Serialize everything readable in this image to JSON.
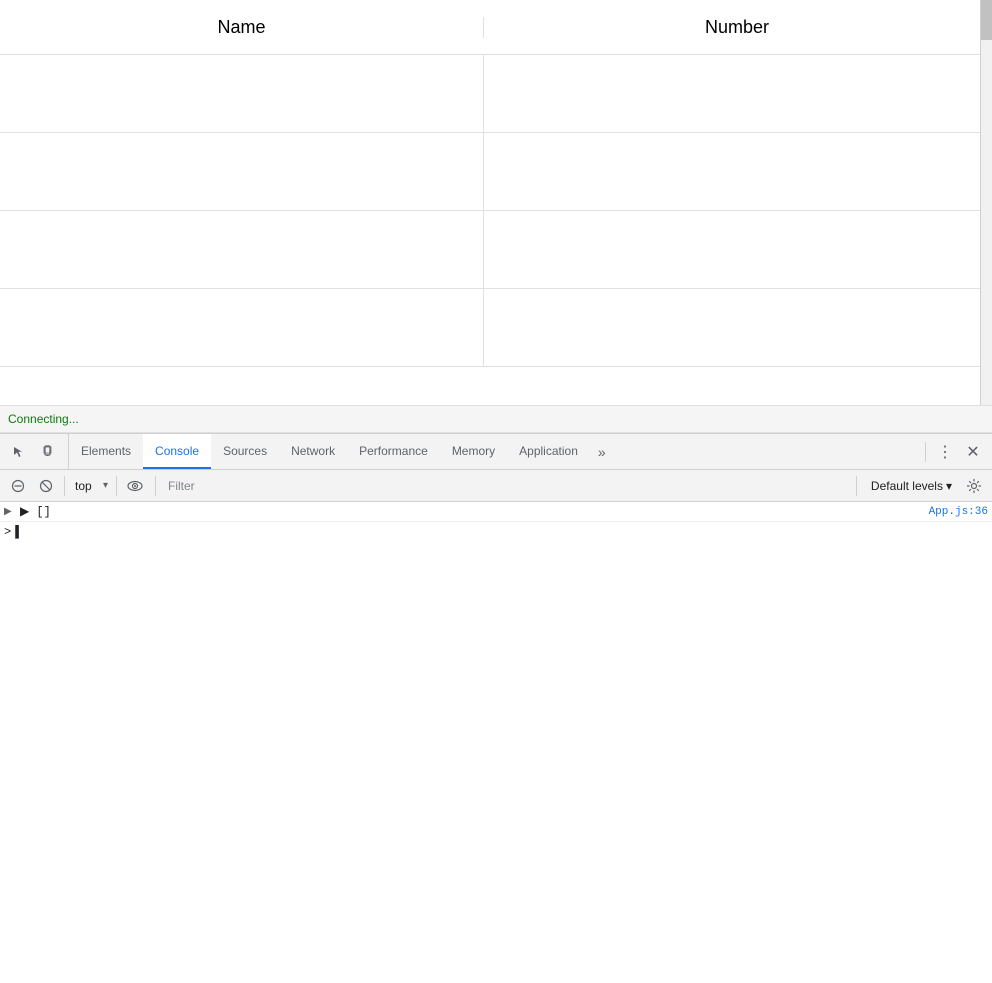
{
  "table": {
    "columns": [
      {
        "id": "name",
        "label": "Name"
      },
      {
        "id": "number",
        "label": "Number"
      }
    ],
    "rows": [
      {
        "name": "",
        "number": ""
      },
      {
        "name": "",
        "number": ""
      },
      {
        "name": "",
        "number": ""
      },
      {
        "name": "",
        "number": ""
      }
    ]
  },
  "connecting": {
    "text": "Connecting..."
  },
  "devtools": {
    "tabs": [
      {
        "id": "elements",
        "label": "Elements",
        "active": false
      },
      {
        "id": "console",
        "label": "Console",
        "active": true
      },
      {
        "id": "sources",
        "label": "Sources",
        "active": false
      },
      {
        "id": "network",
        "label": "Network",
        "active": false
      },
      {
        "id": "performance",
        "label": "Performance",
        "active": false
      },
      {
        "id": "memory",
        "label": "Memory",
        "active": false
      },
      {
        "id": "application",
        "label": "Application",
        "active": false
      }
    ],
    "more_label": "»",
    "dots_label": "⋮",
    "close_label": "✕"
  },
  "console_toolbar": {
    "context_options": [
      "top"
    ],
    "context_selected": "top",
    "filter_placeholder": "Filter",
    "default_levels_label": "Default levels",
    "dropdown_arrow": "▾"
  },
  "console_log": {
    "array_label": "▶ []",
    "source_link": "App.js:36",
    "input_prompt": ">"
  }
}
